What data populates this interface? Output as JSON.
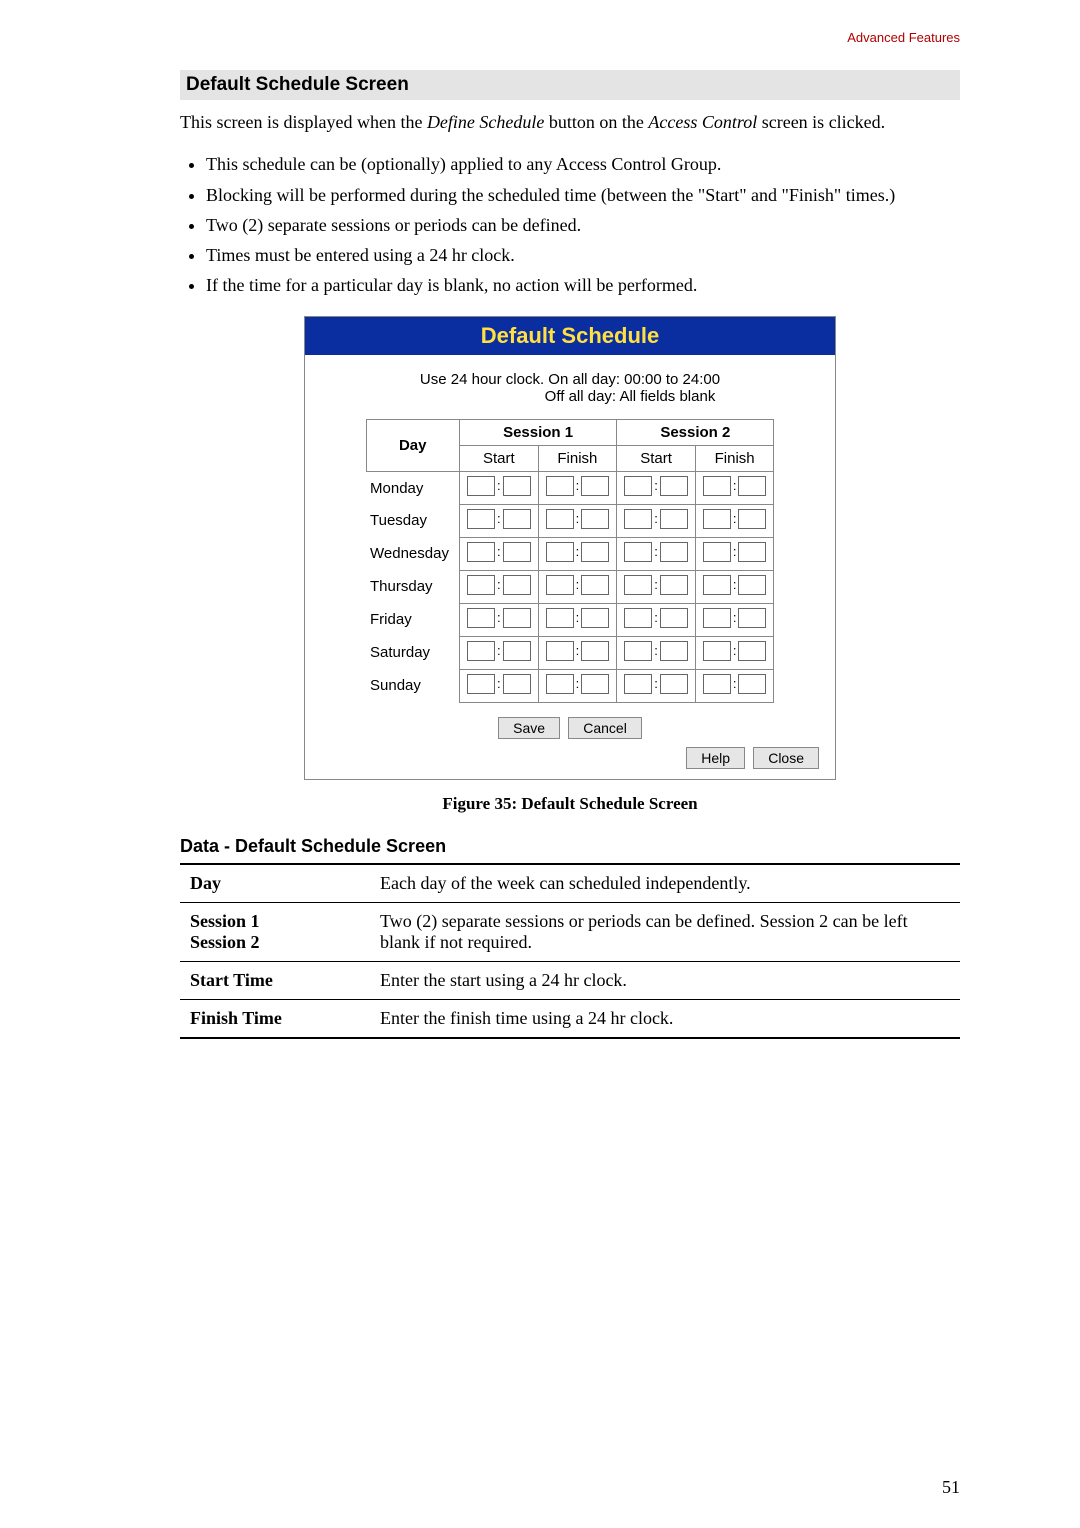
{
  "header_right": "Advanced Features",
  "section_title": "Default Schedule Screen",
  "intro_parts": {
    "p1_pre": "This screen is displayed when the ",
    "p1_em1": "Define Schedule",
    "p1_mid": " button on the ",
    "p1_em2": "Access Control",
    "p1_post": " screen is clicked."
  },
  "bullets": [
    "This schedule can be (optionally) applied to any Access Control Group.",
    "Blocking will be performed during the scheduled time (between the \"Start\" and \"Finish\" times.)",
    "Two (2) separate sessions or periods can be defined.",
    "Times must be entered using a 24 hr clock.",
    "If the time for a particular day is blank, no action will be performed."
  ],
  "panel": {
    "title": "Default Schedule",
    "note_line1": "Use 24 hour clock.  On all day: 00:00 to 24:00",
    "note_line2": "Off all day: All fields blank",
    "headers": {
      "day": "Day",
      "session1": "Session 1",
      "session2": "Session 2",
      "start": "Start",
      "finish": "Finish"
    },
    "days": [
      "Monday",
      "Tuesday",
      "Wednesday",
      "Thursday",
      "Friday",
      "Saturday",
      "Sunday"
    ],
    "buttons": {
      "save": "Save",
      "cancel": "Cancel",
      "help": "Help",
      "close": "Close"
    }
  },
  "figure_caption": "Figure 35: Default Schedule Screen",
  "data_section": {
    "heading": "Data - Default Schedule Screen",
    "rows": [
      {
        "label": "Day",
        "desc": "Each day of the week can scheduled independently."
      },
      {
        "label": "Session 1\nSession 2",
        "desc": "Two (2) separate sessions or periods can be defined. Session 2 can be left blank if not required."
      },
      {
        "label": "Start Time",
        "desc": "Enter the start using a 24 hr clock."
      },
      {
        "label": "Finish Time",
        "desc": "Enter the finish time using a 24 hr clock."
      }
    ]
  },
  "page_number": "51"
}
